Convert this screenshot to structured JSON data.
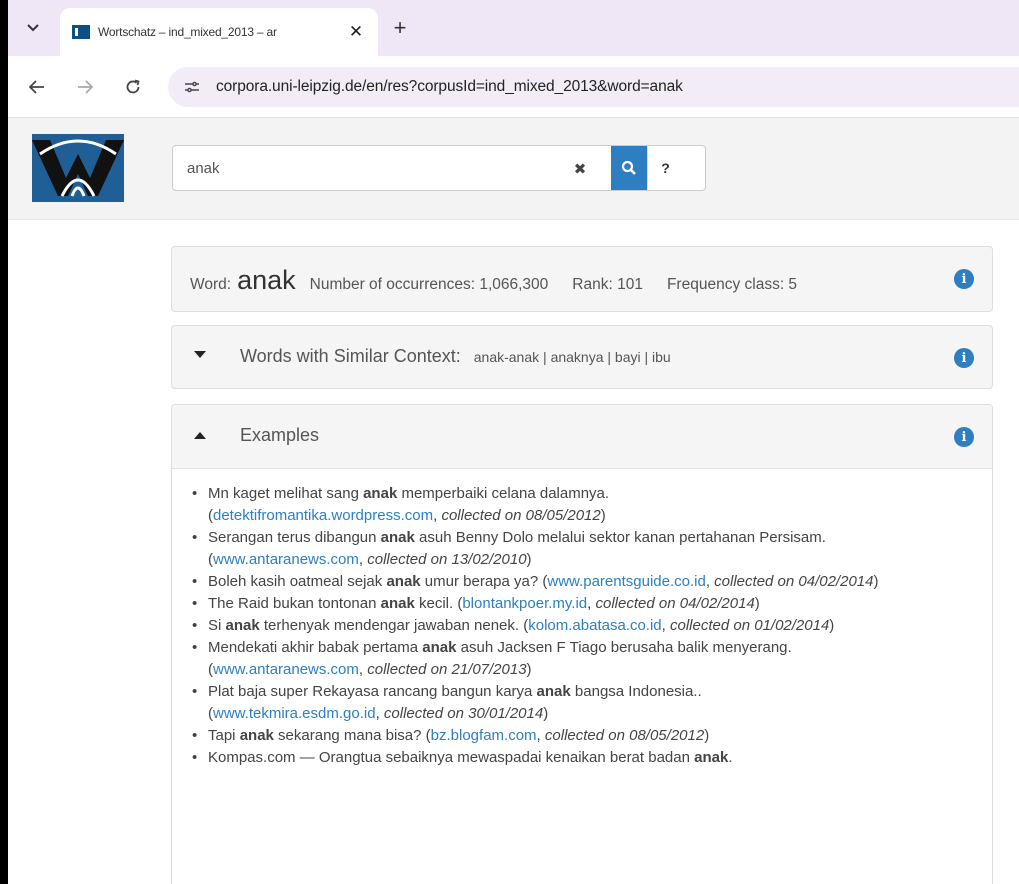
{
  "browser": {
    "tab_title": "Wortschatz – ind_mixed_2013 – ar",
    "tab_menu_icon": "chevron-down-icon",
    "close_glyph": "✕",
    "new_tab_glyph": "+",
    "url": "corpora.uni-leipzig.de/en/res?corpusId=ind_mixed_2013&word=anak"
  },
  "search": {
    "value": "anak",
    "clear_glyph": "✖",
    "help_label": "?"
  },
  "word_panel": {
    "word_label": "Word:",
    "word": "anak",
    "occurrences": "Number of occurrences: 1,066,300",
    "rank": "Rank: 101",
    "frequency_class": "Frequency class: 5",
    "info_glyph": "i"
  },
  "similar_panel": {
    "title": "Words with Similar Context:",
    "words": [
      "anak-anak",
      "anaknya",
      "bayi",
      "ibu"
    ],
    "separator": " | "
  },
  "examples_panel": {
    "title": "Examples",
    "items": [
      {
        "before": "Mn kaget melihat sang ",
        "word": "anak",
        "after": " memperbaiki celana dalamnya.",
        "source": "detektifromantika.wordpress.com",
        "collected": "collected on 08/05/2012",
        "break": true
      },
      {
        "before": "Serangan terus dibangun ",
        "word": "anak",
        "after": " asuh Benny Dolo melalui sektor kanan pertahanan Persisam.",
        "source": "www.antaranews.com",
        "collected": "collected on 13/02/2010",
        "break": false
      },
      {
        "before": "Boleh kasih oatmeal sejak ",
        "word": "anak",
        "after": " umur berapa ya?",
        "source": "www.parentsguide.co.id",
        "collected": "collected on 04/02/2014",
        "break": false
      },
      {
        "before": "The Raid bukan tontonan ",
        "word": "anak",
        "after": " kecil.",
        "source": "blontankpoer.my.id",
        "collected": "collected on 04/02/2014",
        "break": false
      },
      {
        "before": "Si ",
        "word": "anak",
        "after": " terhenyak mendengar jawaban nenek.",
        "source": "kolom.abatasa.co.id",
        "collected": "collected on 01/02/2014",
        "break": false
      },
      {
        "before": "Mendekati akhir babak pertama ",
        "word": "anak",
        "after": " asuh Jacksen F Tiago berusaha balik menyerang.",
        "source": "www.antaranews.com",
        "collected": "collected on 21/07/2013",
        "break": true
      },
      {
        "before": "Plat baja super Rekayasa rancang bangun karya ",
        "word": "anak",
        "after": " bangsa Indonesia..",
        "source": "www.tekmira.esdm.go.id",
        "collected": "collected on 30/01/2014",
        "break": true
      },
      {
        "before": "Tapi ",
        "word": "anak",
        "after": " sekarang mana bisa?",
        "source": "bz.blogfam.com",
        "collected": "collected on 08/05/2012",
        "break": false
      },
      {
        "before": "Kompas.com — Orangtua sebaiknya mewaspadai kenaikan berat badan ",
        "word": "anak",
        "after": ".",
        "source": "",
        "collected": "",
        "break": false
      }
    ]
  },
  "colors": {
    "accent": "#2d7fc1",
    "tabstrip": "#efe7f6",
    "logo": "#1f5f96"
  }
}
